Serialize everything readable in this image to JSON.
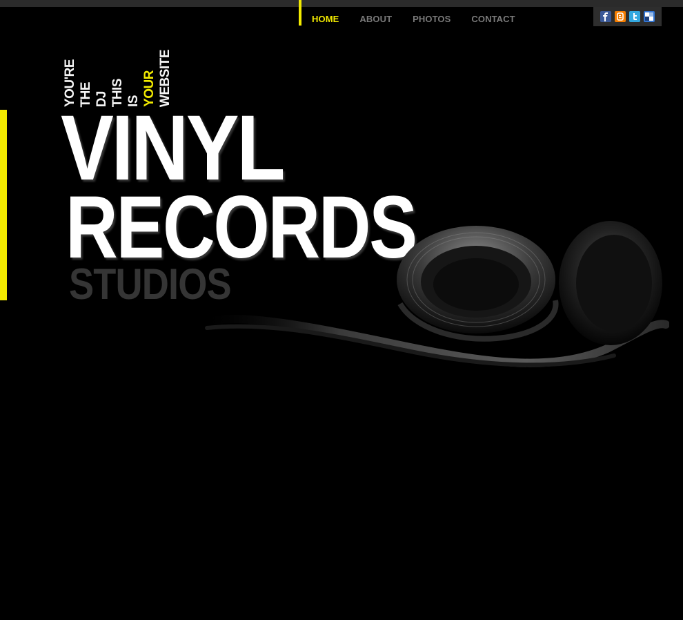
{
  "nav": {
    "items": [
      {
        "label": "HOME",
        "active": true
      },
      {
        "label": "ABOUT",
        "active": false
      },
      {
        "label": "PHOTOS",
        "active": false
      },
      {
        "label": "CONTACT",
        "active": false
      }
    ]
  },
  "social": {
    "icons": [
      "facebook-icon",
      "blogger-icon",
      "twitter-icon",
      "delicious-icon"
    ]
  },
  "tagline": {
    "words": [
      "YOU'RE",
      "THE",
      "DJ",
      "THIS",
      "IS",
      "YOUR",
      "WEBSITE"
    ],
    "highlight": "YOUR"
  },
  "logo": {
    "line1": "VINYL",
    "line2": "RECORDS",
    "line3": "STUDIOS"
  },
  "colors": {
    "accent": "#f2ea00",
    "background": "#000000",
    "nav_inactive": "#7a7a7a"
  }
}
